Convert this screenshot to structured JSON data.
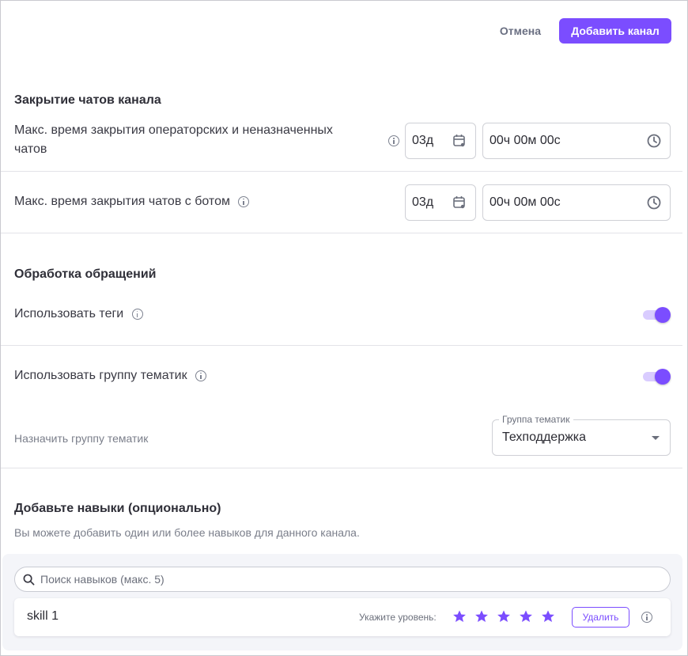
{
  "header": {
    "cancel_label": "Отмена",
    "add_label": "Добавить канал"
  },
  "closing": {
    "title": "Закрытие чатов канала",
    "row1_label_line1": "Макс. время закрытия операторских и неназначенных",
    "row1_label_line2": "чатов",
    "row1_days": "03д",
    "row1_time": "00ч 00м 00с",
    "row2_label": "Макс. время закрытия чатов с ботом",
    "row2_days": "03д",
    "row2_time": "00ч 00м 00с"
  },
  "processing": {
    "title": "Обработка обращений",
    "use_tags_label": "Использовать теги",
    "use_tags_enabled": true,
    "use_topic_group_label": "Использовать группу тематик",
    "use_topic_group_enabled": true,
    "assign_group_label": "Назначить группу тематик",
    "group_legend": "Группа тематик",
    "group_value": "Техподдержка"
  },
  "skills": {
    "title": "Добавьте навыки (опционально)",
    "subtitle": "Вы можете добавить один или более навыков для данного канала.",
    "search_placeholder": "Поиск навыков (макс. 5)",
    "items": [
      {
        "name": "skill 1",
        "level_label": "Укажите уровень:",
        "stars": 5,
        "delete_label": "Удалить"
      }
    ]
  },
  "colors": {
    "accent": "#7b4dff",
    "accent_light": "#d9ccff",
    "text_primary": "#2b2b33",
    "text_muted": "#6c707c"
  }
}
